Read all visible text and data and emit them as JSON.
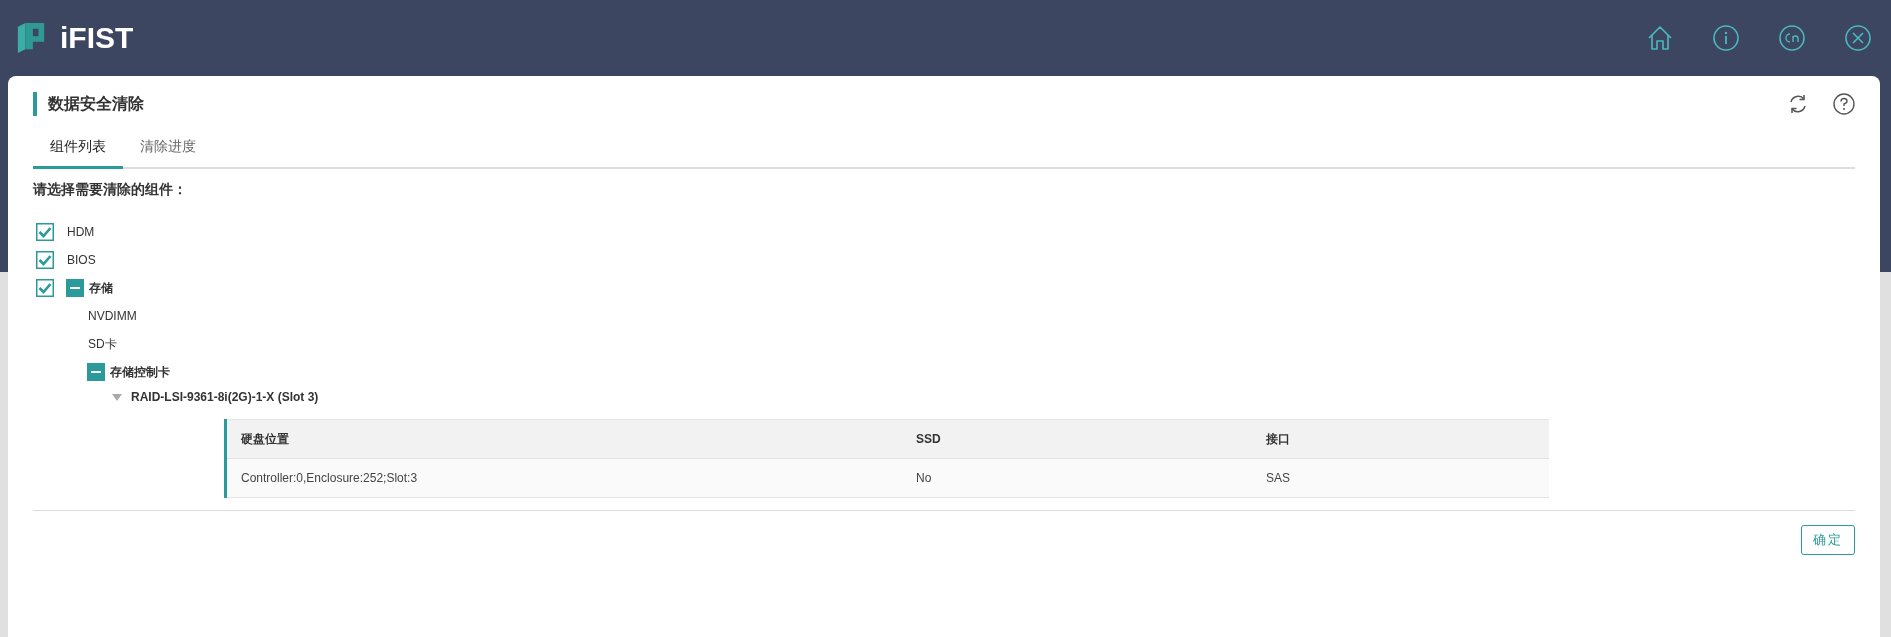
{
  "header": {
    "app_name": "iFIST"
  },
  "page": {
    "title": "数据安全清除"
  },
  "tabs": [
    {
      "label": "组件列表",
      "selected": true
    },
    {
      "label": "清除进度",
      "selected": false
    }
  ],
  "prompt": "请选择需要清除的组件：",
  "tree": [
    {
      "kind": "check",
      "label": "HDM",
      "checked": true
    },
    {
      "kind": "check",
      "label": "BIOS",
      "checked": true
    },
    {
      "kind": "check",
      "label": "存储",
      "checked": true,
      "expanded": true,
      "children": [
        {
          "kind": "leaf",
          "label": "NVDIMM"
        },
        {
          "kind": "leaf",
          "label": "SD卡"
        },
        {
          "kind": "group",
          "label": "存储控制卡",
          "expanded": true,
          "children": [
            {
              "kind": "controller",
              "label": "RAID-LSI-9361-8i(2G)-1-X (Slot 3)",
              "expanded": true,
              "table": {
                "columns": [
                  "硬盘位置",
                  "SSD",
                  "接口"
                ],
                "rows": [
                  [
                    "Controller:0,Enclosure:252;Slot:3",
                    "No",
                    "SAS"
                  ]
                ]
              }
            }
          ]
        }
      ]
    }
  ],
  "buttons": [
    {
      "label": "确定"
    }
  ]
}
